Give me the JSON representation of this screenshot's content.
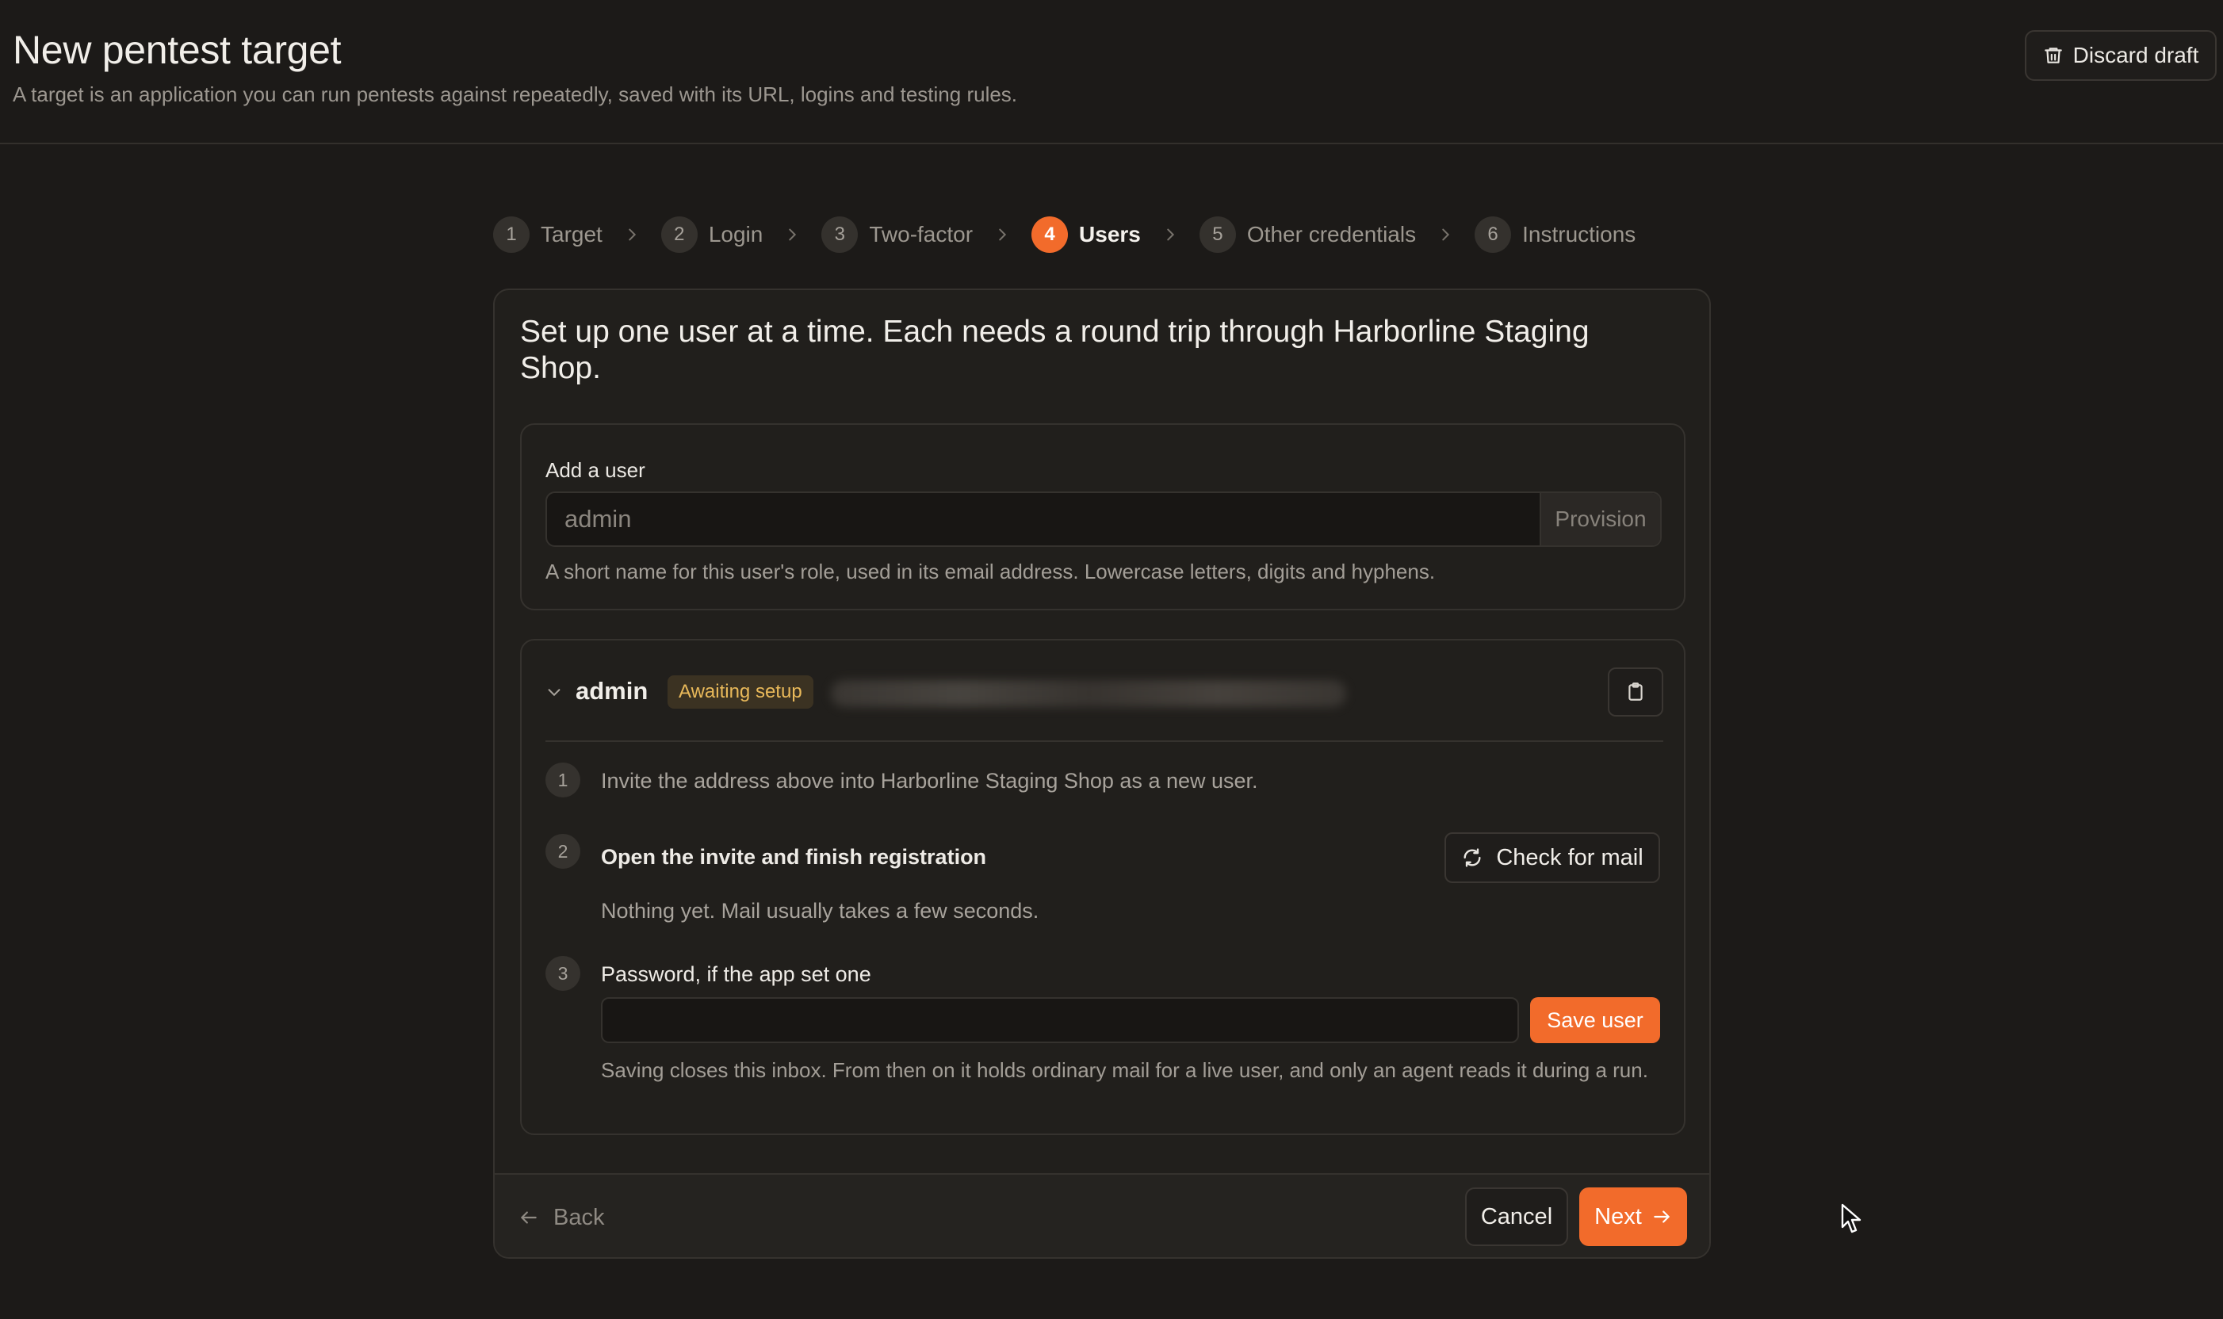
{
  "header": {
    "title": "New pentest target",
    "subtitle": "A target is an application you can run pentests against repeatedly, saved with its URL, logins and testing rules.",
    "discard_label": "Discard draft"
  },
  "stepper": {
    "active_step": 4,
    "steps": [
      {
        "num": "1",
        "label": "Target"
      },
      {
        "num": "2",
        "label": "Login"
      },
      {
        "num": "3",
        "label": "Two-factor"
      },
      {
        "num": "4",
        "label": "Users"
      },
      {
        "num": "5",
        "label": "Other credentials"
      },
      {
        "num": "6",
        "label": "Instructions"
      }
    ]
  },
  "card": {
    "heading": "Set up one user at a time. Each needs a round trip through Harborline Staging Shop."
  },
  "add_user": {
    "label": "Add a user",
    "placeholder": "admin",
    "value": "",
    "provision_label": "Provision",
    "help": "A short name for this user's role, used in its email address. Lowercase letters, digits and hyphens."
  },
  "user": {
    "name": "admin",
    "status": "Awaiting setup",
    "steps": [
      {
        "num": "1",
        "text": "Invite the address above into Harborline Staging Shop as a new user."
      },
      {
        "num": "2",
        "title": "Open the invite and finish registration",
        "text": "Nothing yet. Mail usually takes a few seconds.",
        "action": "Check for mail"
      },
      {
        "num": "3",
        "label": "Password, if the app set one",
        "value": "",
        "action": "Save user",
        "help": "Saving closes this inbox. From then on it holds ordinary mail for a live user, and only an agent reads it during a run."
      }
    ]
  },
  "footer": {
    "back_label": "Back",
    "cancel_label": "Cancel",
    "next_label": "Next"
  },
  "colors": {
    "accent": "#f26b2b",
    "background": "#1c1a18",
    "badge_text": "#e9b95a"
  },
  "icons": {
    "discard": "trash-icon",
    "separator": "chevron-right-icon",
    "expand": "chevron-down-icon",
    "copy": "clipboard-icon",
    "refresh": "refresh-icon",
    "back": "arrow-left-icon",
    "next": "arrow-right-icon"
  }
}
